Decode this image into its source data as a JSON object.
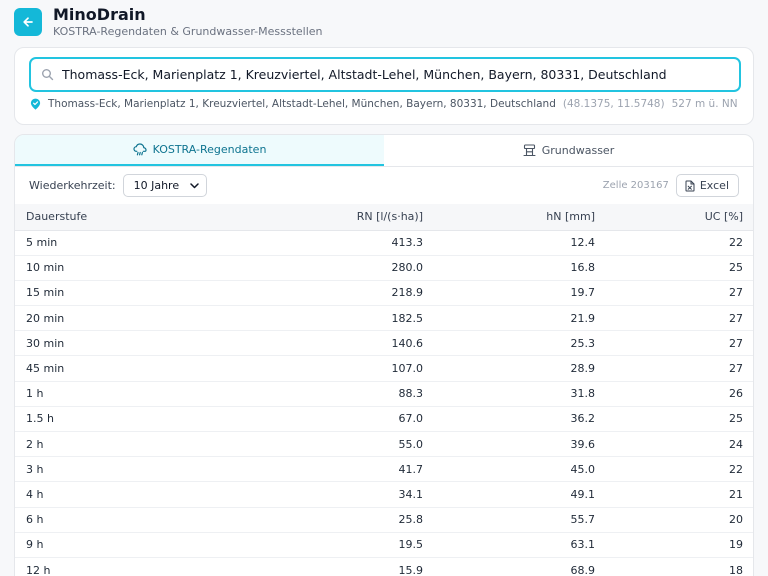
{
  "app": {
    "title": "MinoDrain",
    "subtitle": "KOSTRA-Regendaten & Grundwasser-Messstellen",
    "accent_color": "#14b8d8"
  },
  "search": {
    "value": "Thomass-Eck, Marienplatz 1, Kreuzviertel, Altstadt-Lehel, München, Bayern, 80331, Deutschland",
    "location_text": "Thomass-Eck, Marienplatz 1, Kreuzviertel, Altstadt-Lehel, München, Bayern, 80331, Deutschland",
    "coords": "(48.1375, 11.5748)",
    "altitude": "527 m ü. NN"
  },
  "tabs": [
    {
      "label": "KOSTRA-Regendaten",
      "icon": "cloud-rain-icon",
      "active": true
    },
    {
      "label": "Grundwasser",
      "icon": "groundwater-icon",
      "active": false
    }
  ],
  "toolbar": {
    "return_period_label": "Wiederkehrzeit:",
    "return_period_value": "10 Jahre",
    "cell_label": "Zelle 203167",
    "excel_label": "Excel"
  },
  "table": {
    "headers": [
      "Dauerstufe",
      "RN [l/(s·ha)]",
      "hN [mm]",
      "UC [%]"
    ],
    "rows": [
      [
        "5 min",
        "413.3",
        "12.4",
        "22"
      ],
      [
        "10 min",
        "280.0",
        "16.8",
        "25"
      ],
      [
        "15 min",
        "218.9",
        "19.7",
        "27"
      ],
      [
        "20 min",
        "182.5",
        "21.9",
        "27"
      ],
      [
        "30 min",
        "140.6",
        "25.3",
        "27"
      ],
      [
        "45 min",
        "107.0",
        "28.9",
        "27"
      ],
      [
        "1 h",
        "88.3",
        "31.8",
        "26"
      ],
      [
        "1.5 h",
        "67.0",
        "36.2",
        "25"
      ],
      [
        "2 h",
        "55.0",
        "39.6",
        "24"
      ],
      [
        "3 h",
        "41.7",
        "45.0",
        "22"
      ],
      [
        "4 h",
        "34.1",
        "49.1",
        "21"
      ],
      [
        "6 h",
        "25.8",
        "55.7",
        "20"
      ],
      [
        "9 h",
        "19.5",
        "63.1",
        "19"
      ],
      [
        "12 h",
        "15.9",
        "68.9",
        "18"
      ]
    ]
  }
}
